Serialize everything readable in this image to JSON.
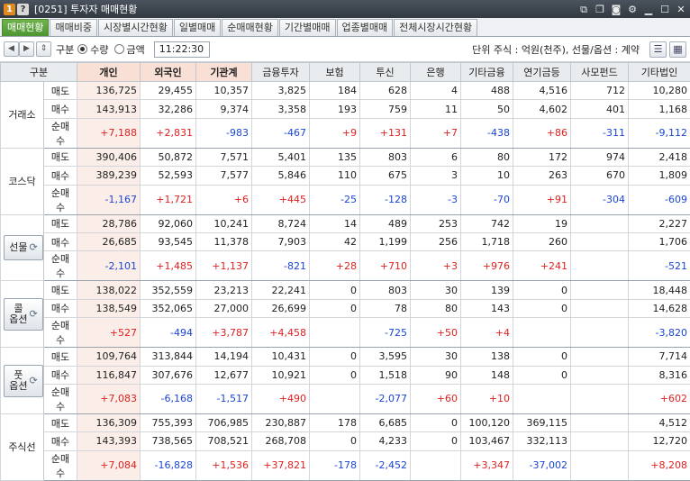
{
  "window": {
    "num1": "1",
    "num2": "?",
    "title": "[0251] 투자자 매매현황"
  },
  "tabs": [
    {
      "label": "매매현황",
      "active": true
    },
    {
      "label": "매매비중"
    },
    {
      "label": "시장별시간현황"
    },
    {
      "label": "일별매매"
    },
    {
      "label": "순매매현황"
    },
    {
      "label": "기간별매매"
    },
    {
      "label": "업종별매매"
    },
    {
      "label": "전체시장시간현황"
    }
  ],
  "toolbar": {
    "kind_label": "구분",
    "radio_qty": "수량",
    "radio_amt": "금액",
    "time": "11:22:30",
    "unit_text": "단위 주식 : 억원(천주), 선물/옵션 : 계약"
  },
  "table": {
    "headers": [
      "구분",
      "개인",
      "외국인",
      "기관계",
      "금융투자",
      "보험",
      "투신",
      "은행",
      "기타금융",
      "연기금등",
      "사모펀드",
      "기타법인"
    ],
    "row_labels": [
      "매도",
      "매수",
      "순매수"
    ],
    "groups": [
      {
        "name": "거래소",
        "button": false,
        "rows": [
          [
            "136,725",
            "29,455",
            "10,357",
            "3,825",
            "184",
            "628",
            "4",
            "488",
            "4,516",
            "712",
            "10,280"
          ],
          [
            "143,913",
            "32,286",
            "9,374",
            "3,358",
            "193",
            "759",
            "11",
            "50",
            "4,602",
            "401",
            "1,168"
          ],
          [
            "+7,188",
            "+2,831",
            "-983",
            "-467",
            "+9",
            "+131",
            "+7",
            "-438",
            "+86",
            "-311",
            "-9,112"
          ]
        ]
      },
      {
        "name": "코스닥",
        "button": false,
        "rows": [
          [
            "390,406",
            "50,872",
            "7,571",
            "5,401",
            "135",
            "803",
            "6",
            "80",
            "172",
            "974",
            "2,418"
          ],
          [
            "389,239",
            "52,593",
            "7,577",
            "5,846",
            "110",
            "675",
            "3",
            "10",
            "263",
            "670",
            "1,809"
          ],
          [
            "-1,167",
            "+1,721",
            "+6",
            "+445",
            "-25",
            "-128",
            "-3",
            "-70",
            "+91",
            "-304",
            "-609"
          ]
        ]
      },
      {
        "name": "선물",
        "button": true,
        "rows": [
          [
            "28,786",
            "92,060",
            "10,241",
            "8,724",
            "14",
            "489",
            "253",
            "742",
            "19",
            "",
            "2,227"
          ],
          [
            "26,685",
            "93,545",
            "11,378",
            "7,903",
            "42",
            "1,199",
            "256",
            "1,718",
            "260",
            "",
            "1,706"
          ],
          [
            "-2,101",
            "+1,485",
            "+1,137",
            "-821",
            "+28",
            "+710",
            "+3",
            "+976",
            "+241",
            "",
            "-521"
          ]
        ]
      },
      {
        "name": "콜\n옵션",
        "button": true,
        "rows": [
          [
            "138,022",
            "352,559",
            "23,213",
            "22,241",
            "0",
            "803",
            "30",
            "139",
            "0",
            "",
            "18,448"
          ],
          [
            "138,549",
            "352,065",
            "27,000",
            "26,699",
            "0",
            "78",
            "80",
            "143",
            "0",
            "",
            "14,628"
          ],
          [
            "+527",
            "-494",
            "+3,787",
            "+4,458",
            "",
            "-725",
            "+50",
            "+4",
            "",
            "",
            "-3,820"
          ]
        ]
      },
      {
        "name": "풋\n옵션",
        "button": true,
        "rows": [
          [
            "109,764",
            "313,844",
            "14,194",
            "10,431",
            "0",
            "3,595",
            "30",
            "138",
            "0",
            "",
            "7,714"
          ],
          [
            "116,847",
            "307,676",
            "12,677",
            "10,921",
            "0",
            "1,518",
            "90",
            "148",
            "0",
            "",
            "8,316"
          ],
          [
            "+7,083",
            "-6,168",
            "-1,517",
            "+490",
            "",
            "-2,077",
            "+60",
            "+10",
            "",
            "",
            "+602"
          ]
        ]
      },
      {
        "name": "주식선",
        "button": false,
        "rows": [
          [
            "136,309",
            "755,393",
            "706,985",
            "230,887",
            "178",
            "6,685",
            "0",
            "100,120",
            "369,115",
            "",
            "4,512"
          ],
          [
            "143,393",
            "738,565",
            "708,521",
            "268,708",
            "0",
            "4,233",
            "0",
            "103,467",
            "332,113",
            "",
            "12,720"
          ],
          [
            "+7,084",
            "-16,828",
            "+1,536",
            "+37,821",
            "-178",
            "-2,452",
            "",
            "+3,347",
            "-37,002",
            "",
            "+8,208"
          ]
        ]
      }
    ]
  },
  "colors": {
    "up": "#e02020",
    "down": "#1a46d6",
    "active_tab": "#5aa33c"
  }
}
